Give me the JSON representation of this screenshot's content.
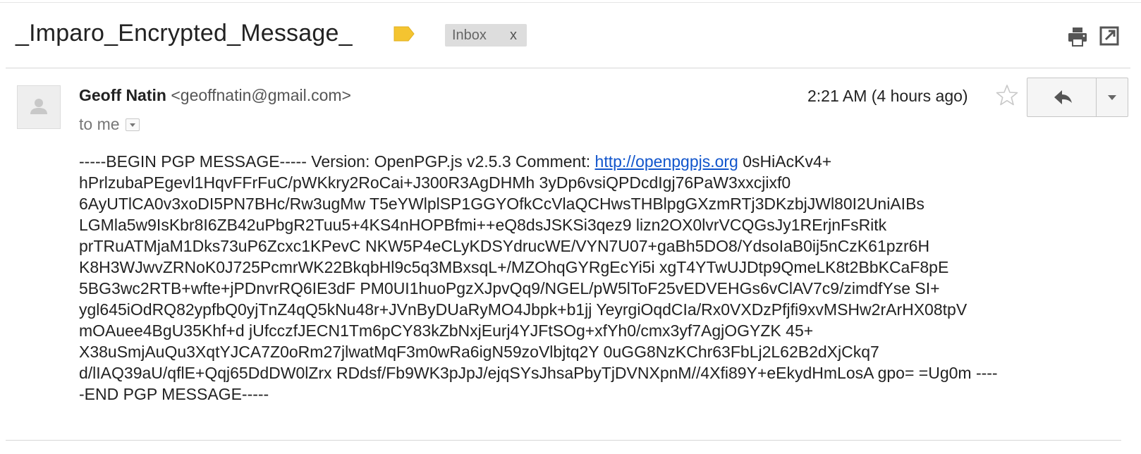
{
  "thread": {
    "subject": "_Imparo_Encrypted_Message_",
    "label_color": "#f4c430",
    "labels": [
      {
        "name": "Inbox",
        "close": "x"
      }
    ],
    "icons": {
      "print": "print-icon",
      "popout": "open-in-new-window-icon"
    }
  },
  "message": {
    "sender_name": "Geoff Natin",
    "sender_email": "<geoffnatin@gmail.com>",
    "to": "to me",
    "timestamp": "2:21 AM (4 hours ago)",
    "icons": {
      "avatar": "person-icon",
      "star": "star-icon",
      "reply": "reply-icon",
      "more": "dropdown-arrow-icon"
    },
    "link_color": "#1155cc",
    "body_before": "-----BEGIN PGP MESSAGE----- Version: OpenPGP.js v2.5.3 Comment: ",
    "body_link": "http://openpgpjs.org",
    "body_lines": [
      " 0sHiAcKv4+",
      "hPrlzubaPEgevl1HqvFFrFuC/pWKkry2RoCai+J300R3AgDHMh 3yDp6vsiQPDcdIgj76PaW3xxcjixf0",
      "6AyUTlCA0v3xoDI5PN7BHc/Rw3ugMw T5eYWlplSP1GGYOfkCcVlaQCHwsTHBlpgGXzmRTj3DKzbjJWl80I2UniAIBs",
      "LGMla5w9IsKbr8I6ZB42uPbgR2Tuu5+4KS4nHOPBfmi++eQ8dsJSKSi3qez9 lizn2OX0lvrVCQGsJy1RErjnFsRitk",
      "prTRuATMjaM1Dks73uP6Zcxc1KPevC NKW5P4eCLyKDSYdrucWE/VYN7U07+gaBh5DO8/YdsoIaB0ij5nCzK61pzr6H",
      "K8H3WJwvZRNoK0J725PcmrWK22BkqbHl9c5q3MBxsqL+/MZOhqGYRgEcYi5i xgT4YTwUJDtp9QmeLK8t2BbKCaF8pE",
      "5BG3wc2RTB+wfte+jPDnvrRQ6IE3dF PM0UI1huoPgzXJpvQq9/NGEL/pW5lToF25vEDVEHGs6vClAV7c9/zimdfYse SI+",
      "ygl645iOdRQ82ypfbQ0yjTnZ4qQ5kNu48r+JVnByDUaRyMO4Jbpk+b1jj YeyrgiOqdCIa/Rx0VXDzPfjfi9xvMSHw2rArHX08tpV",
      "mOAuee4BgU35Khf+d jUfcczfJECN1Tm6pCY83kZbNxjEurj4YJFtSOg+xfYh0/cmx3yf7AgjOGYZK 45+",
      "X38uSmjAuQu3XqtYJCA7Z0oRm27jlwatMqF3m0wRa6igN59zoVlbjtq2Y 0uGG8NzKChr63FbLj2L62B2dXjCkq7",
      "d/lIAQ39aU/qflE+Qqj65DdDW0lZrx RDdsf/Fb9WK3pJpJ/ejqSYsJhsaPbyTjDVNXpnM//4Xfi89Y+eEkydHmLosA gpo= =Ug0m ----",
      "-END PGP MESSAGE-----"
    ]
  }
}
